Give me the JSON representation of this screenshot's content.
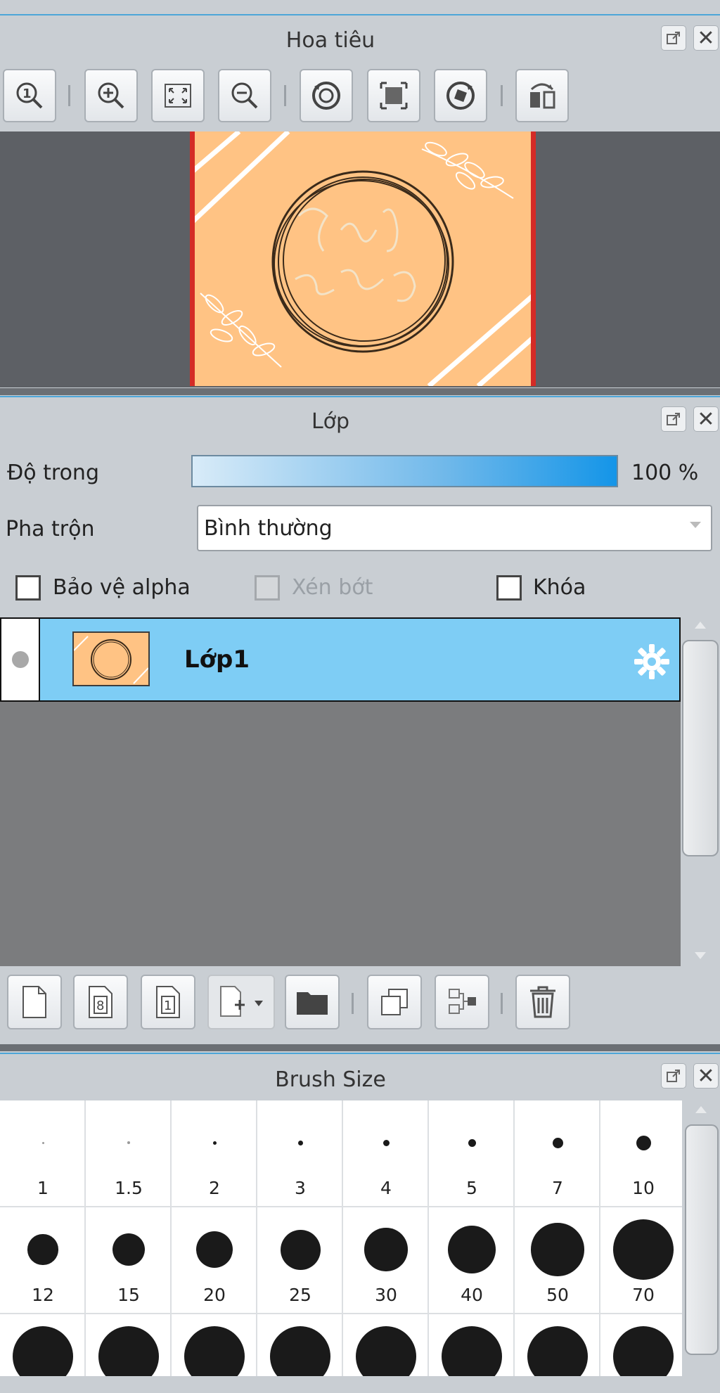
{
  "navigator": {
    "title": "Hoa tiêu",
    "toolbar": [
      "zoom-actual-icon",
      "zoom-in-icon",
      "fit-screen-icon",
      "zoom-out-icon",
      "rotate-left-icon",
      "reset-view-icon",
      "rotate-right-icon",
      "flip-horizontal-icon"
    ]
  },
  "layers": {
    "title": "Lớp",
    "opacity_label": "Độ trong",
    "opacity_value": "100 %",
    "opacity": 1.0,
    "blend_label": "Pha trộn",
    "blend_value": "Bình thường",
    "protect_alpha_label": "Bảo vệ alpha",
    "clip_label": "Xén bớt",
    "lock_label": "Khóa",
    "layer_name": "Lớp1",
    "toolbar": [
      "new-layer-icon",
      "new-8bit-layer-icon",
      "new-1bit-layer-icon",
      "add-layer-menu-icon",
      "folder-icon",
      "duplicate-layer-icon",
      "merge-down-icon",
      "trash-icon"
    ]
  },
  "brush": {
    "title": "Brush Size",
    "sizes": [
      "1",
      "1.5",
      "2",
      "3",
      "4",
      "5",
      "7",
      "10",
      "12",
      "15",
      "20",
      "25",
      "30",
      "40",
      "50",
      "70"
    ]
  },
  "colors": {
    "accent": "#4da6d8",
    "canvas": "#ffc384",
    "layer_selected": "#7ecdf5"
  }
}
